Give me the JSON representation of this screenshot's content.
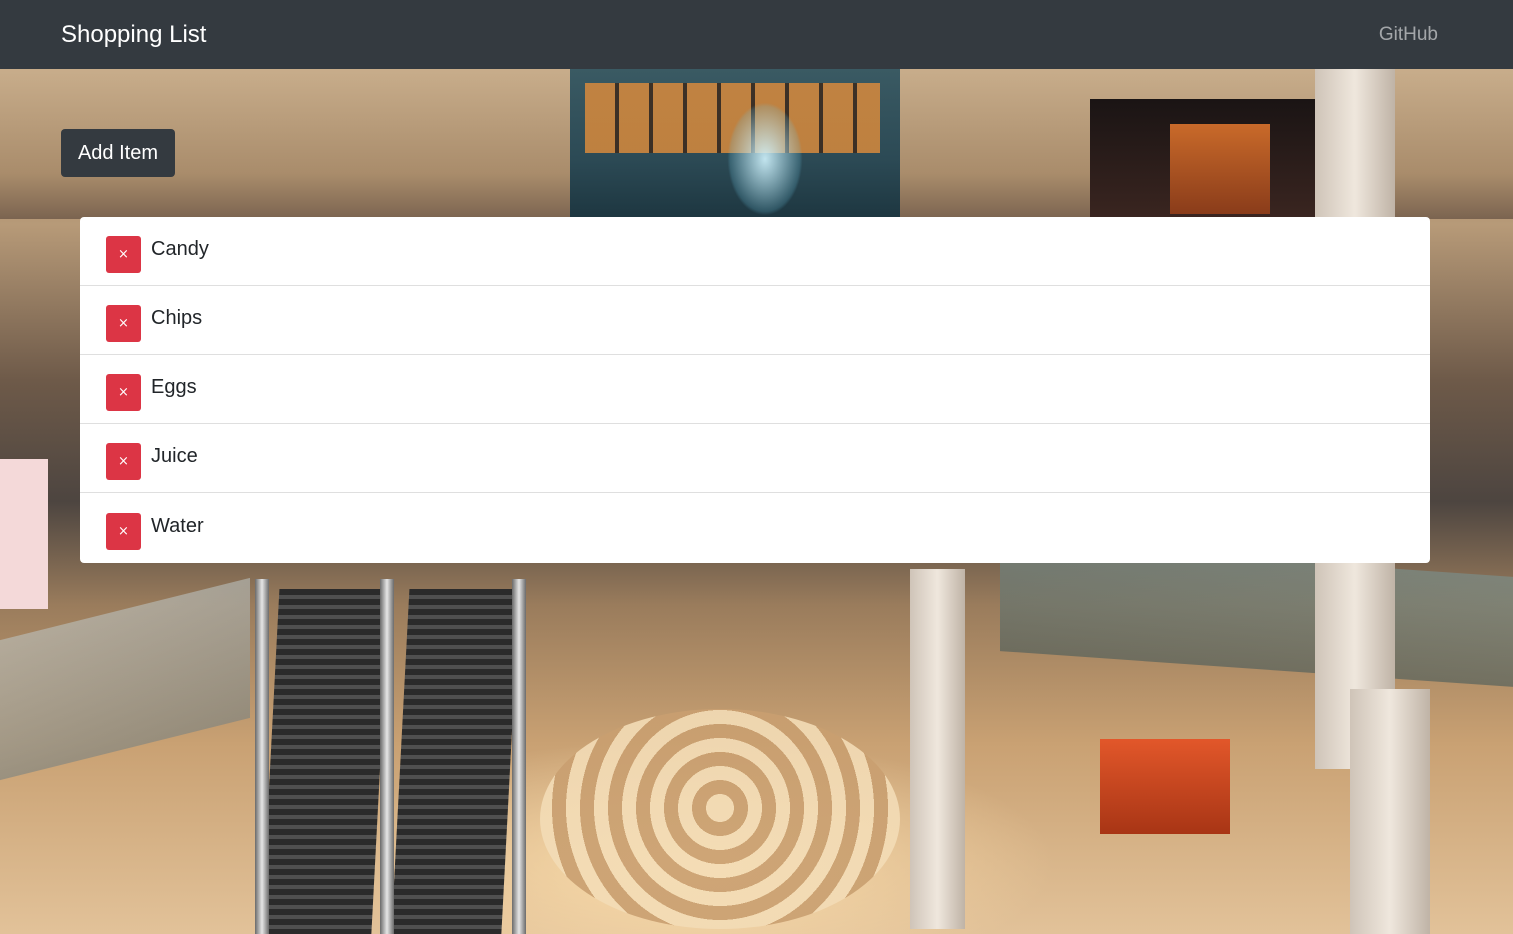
{
  "navbar": {
    "brand": "Shopping List",
    "link": "GitHub"
  },
  "toolbar": {
    "add_label": "Add Item"
  },
  "items": [
    {
      "name": "Candy",
      "remove_label": "×"
    },
    {
      "name": "Chips",
      "remove_label": "×"
    },
    {
      "name": "Eggs",
      "remove_label": "×"
    },
    {
      "name": "Juice",
      "remove_label": "×"
    },
    {
      "name": "Water",
      "remove_label": "×"
    }
  ],
  "colors": {
    "navbar_bg": "#343a40",
    "danger": "#dc3545",
    "list_bg": "#ffffff"
  }
}
